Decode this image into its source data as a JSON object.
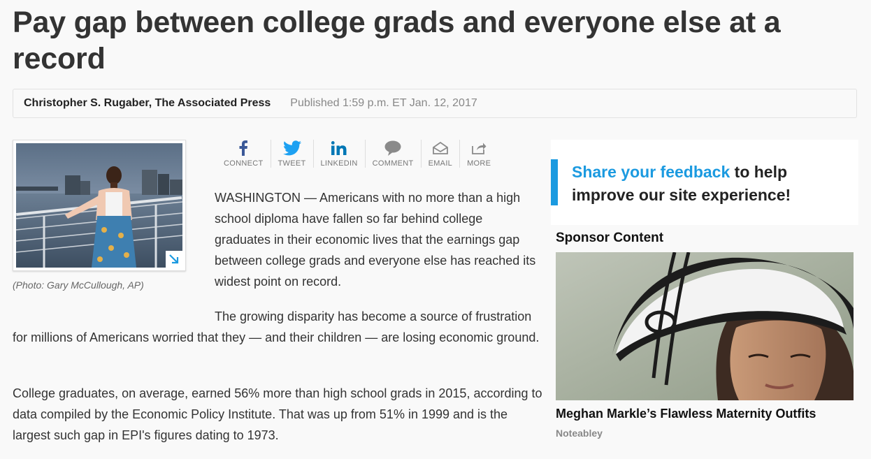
{
  "article": {
    "headline": "Pay gap between college grads and everyone else at a record",
    "author": "Christopher S. Rugaber, The Associated Press",
    "published": "Published 1:59 p.m. ET Jan. 12, 2017",
    "photo_caption": "(Photo: Gary McCullough, AP)",
    "paragraphs": [
      "WASHINGTON — Americans with no more than a high school diploma have fallen so far behind college graduates in their economic lives that the earnings gap between college grads and everyone else has reached its widest point on record.",
      "The growing disparity has become a source of frustration for millions of Americans worried that they — and their children — are losing economic ground.",
      "College graduates, on average, earned 56% more than high school grads in 2015, according to data compiled by the Economic Policy Institute. That was up from 51% in 1999 and is the largest such gap in EPI's figures dating to 1973."
    ]
  },
  "share": {
    "items": [
      {
        "label": "CONNECT",
        "icon": "facebook-icon",
        "color": "#3b5998"
      },
      {
        "label": "TWEET",
        "icon": "twitter-icon",
        "color": "#1da1f2"
      },
      {
        "label": "LINKEDIN",
        "icon": "linkedin-icon",
        "color": "#0077b5"
      },
      {
        "label": "COMMENT",
        "icon": "comment-icon",
        "color": "#888888"
      },
      {
        "label": "EMAIL",
        "icon": "email-icon",
        "color": "#888888"
      },
      {
        "label": "MORE",
        "icon": "share-more-icon",
        "color": "#888888"
      }
    ]
  },
  "feedback": {
    "link_text": "Share your feedback",
    "rest_text": " to help improve our site experience!",
    "accent_color": "#1b9ae0"
  },
  "sponsor": {
    "label": "Sponsor Content",
    "title": "Meghan Markle’s Flawless Maternity Outfits",
    "source": "Noteabley"
  }
}
